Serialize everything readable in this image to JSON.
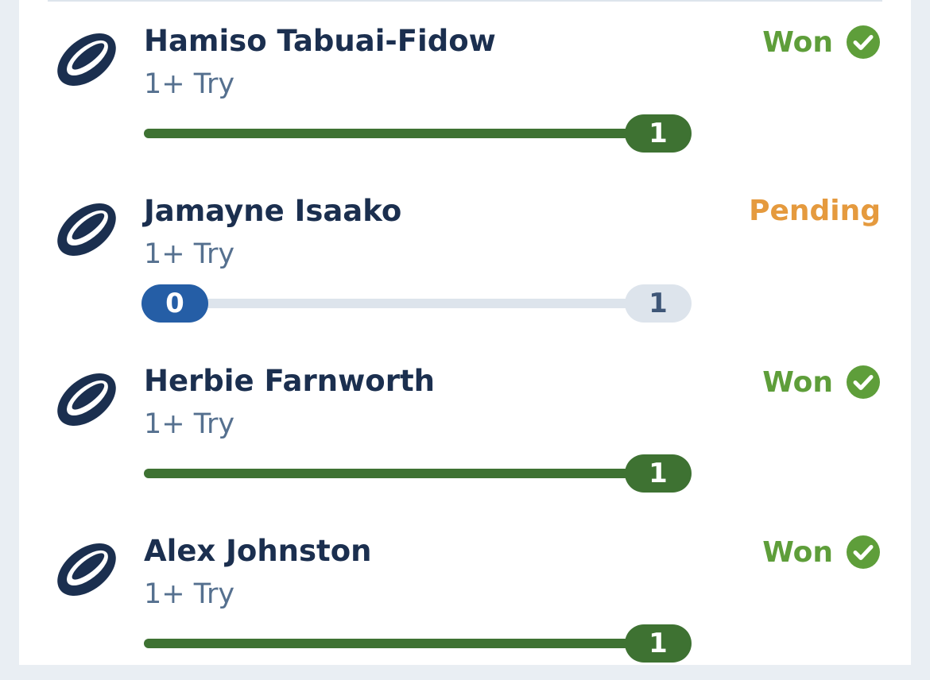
{
  "colors": {
    "won": "#5e9e3a",
    "pending": "#e59a3e",
    "progress_done": "#3e7232",
    "progress_current": "#255ea6",
    "track": "#dde4ec",
    "name": "#1b2f4f",
    "icon": "#1b2f4f"
  },
  "legs": [
    {
      "player": "Hamiso Tabuai-Fidow",
      "market": "1+ Try",
      "status": "Won",
      "status_icon": "check-circle-icon",
      "team_icon": "rugby-league-ball-icon",
      "progress": {
        "current": 1,
        "target": "1",
        "target_label": "1",
        "fraction": 1.0
      }
    },
    {
      "player": "Jamayne Isaako",
      "market": "1+ Try",
      "status": "Pending",
      "status_icon": "",
      "team_icon": "rugby-league-ball-icon",
      "progress": {
        "current": 0,
        "current_label": "0",
        "target": "1",
        "target_label": "1",
        "fraction": 0.0
      }
    },
    {
      "player": "Herbie Farnworth",
      "market": "1+ Try",
      "status": "Won",
      "status_icon": "check-circle-icon",
      "team_icon": "rugby-league-ball-icon",
      "progress": {
        "current": 1,
        "target": "1",
        "target_label": "1",
        "fraction": 1.0
      }
    },
    {
      "player": "Alex Johnston",
      "market": "1+ Try",
      "status": "Won",
      "status_icon": "check-circle-icon",
      "team_icon": "rugby-league-ball-icon",
      "progress": {
        "current": 1,
        "target": "1",
        "target_label": "1",
        "fraction": 1.0
      }
    }
  ]
}
